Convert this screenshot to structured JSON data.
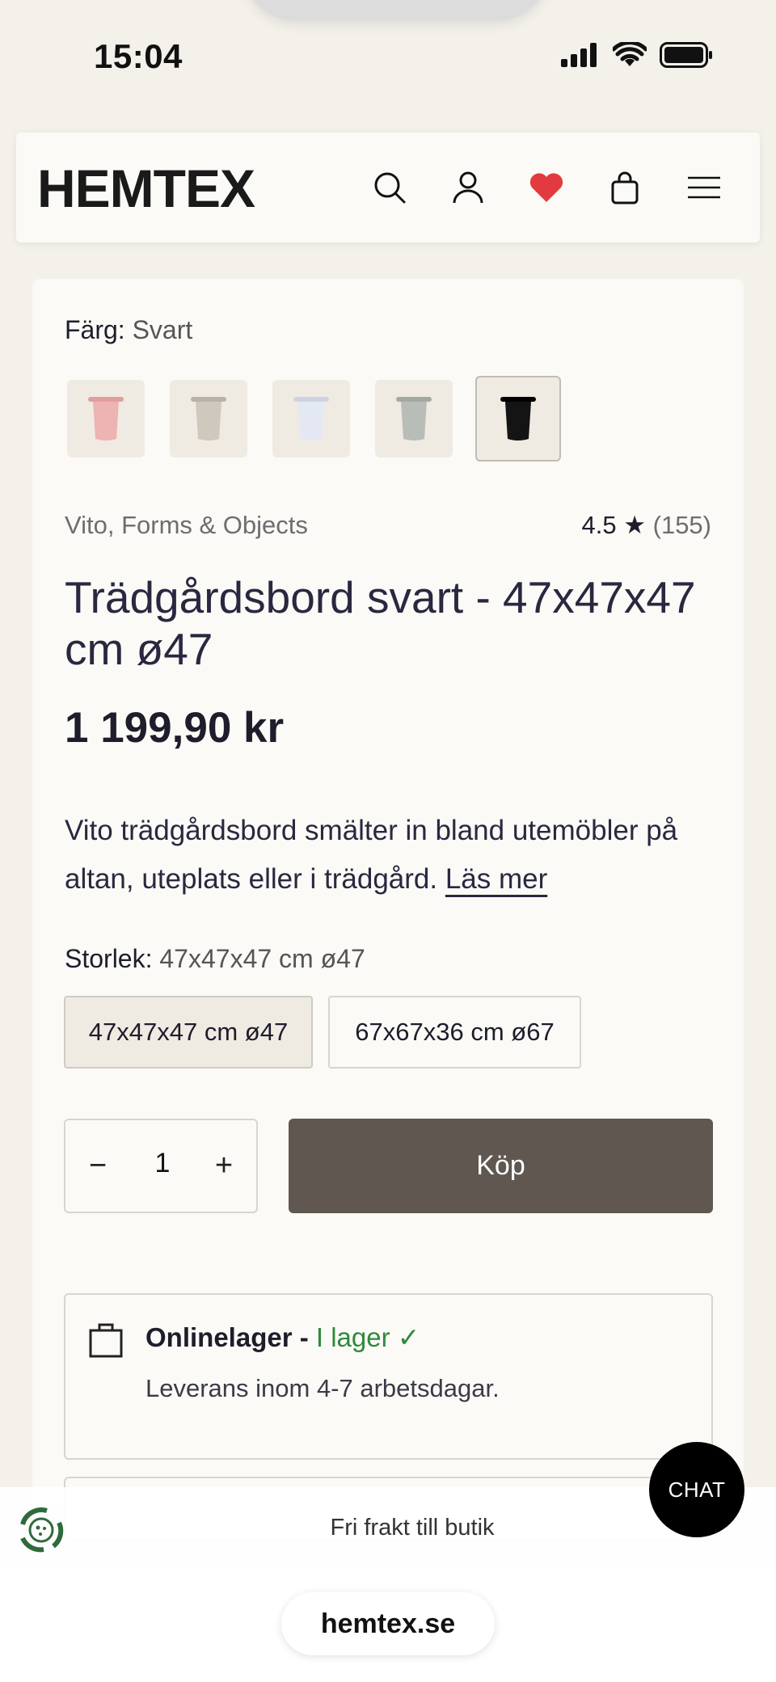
{
  "status_bar": {
    "time": "15:04"
  },
  "header": {
    "logo": "HEMTEX",
    "icons": [
      "search-icon",
      "account-icon",
      "heart-icon",
      "bag-icon",
      "menu-icon"
    ],
    "heart_color": "#e23a3f"
  },
  "product": {
    "color_label": "Färg:",
    "color_value": "Svart",
    "swatches": [
      {
        "name": "rosa",
        "color": "#eeb3b3"
      },
      {
        "name": "beige",
        "color": "#cfc8bd"
      },
      {
        "name": "ljusblå",
        "color": "#e3e8f3"
      },
      {
        "name": "grön",
        "color": "#b9bdb7"
      },
      {
        "name": "svart",
        "color": "#141414",
        "selected": true
      }
    ],
    "brand": "Vito, Forms & Objects",
    "rating_value": "4.5",
    "rating_star": "★",
    "rating_count": "(155)",
    "title": "Trädgårdsbord svart - 47x47x47 cm ø47",
    "price": "1 199,90 kr",
    "description": "Vito trädgårdsbord smälter in bland utemöbler på altan, uteplats eller i trädgård.",
    "read_more": "Läs mer",
    "size_label": "Storlek:",
    "size_value": "47x47x47 cm ø47",
    "sizes": [
      "47x47x47 cm ø47",
      "67x67x36 cm ø67"
    ],
    "quantity": "1",
    "qty_minus": "−",
    "qty_plus": "+",
    "buy_label": "Köp"
  },
  "stock": {
    "title": "Onlinelager - ",
    "status": "I lager ✓",
    "delivery": "Leverans inom 4-7 arbetsdagar.",
    "status_color": "#2e8a3d"
  },
  "banner": {
    "text": "Fri frakt till butik"
  },
  "chat": {
    "label": "CHAT"
  },
  "browser": {
    "url": "hemtex.se"
  }
}
